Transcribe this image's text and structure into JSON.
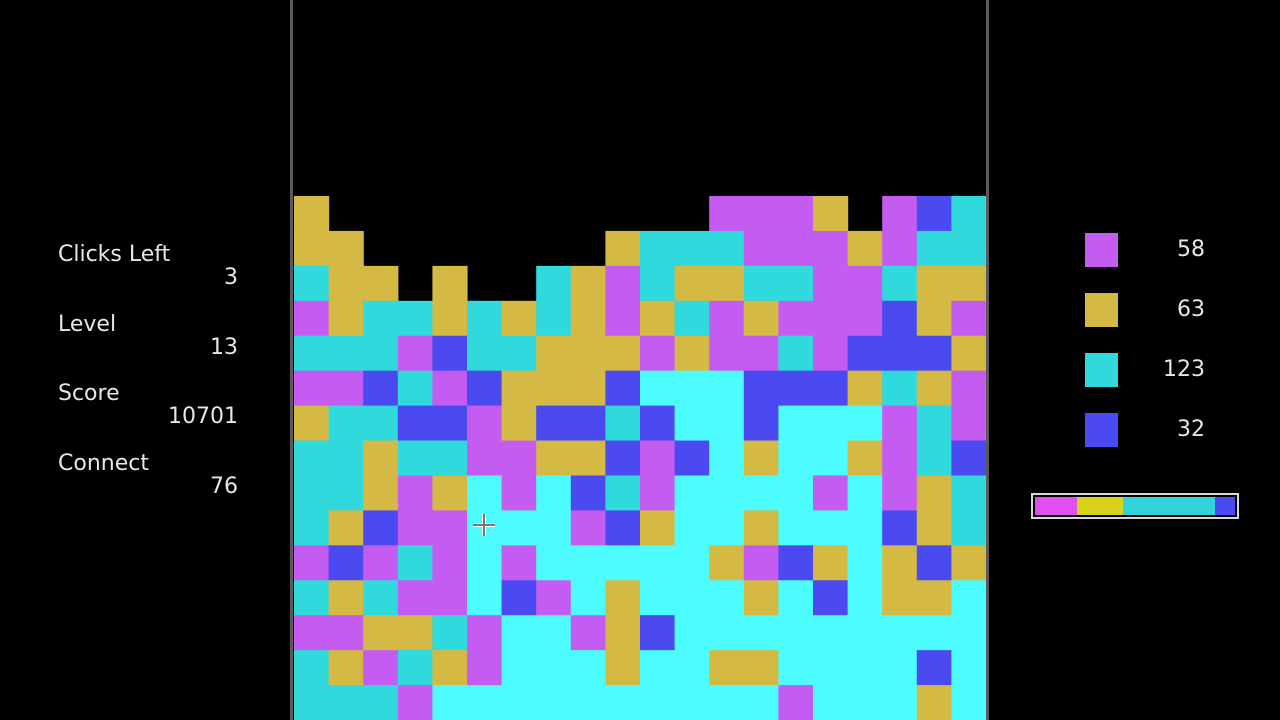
{
  "stats": {
    "clicks_left": {
      "label": "Clicks Left",
      "value": "3"
    },
    "level": {
      "label": "Level",
      "value": "13"
    },
    "score": {
      "label": "Score",
      "value": "10701"
    },
    "connect": {
      "label": "Connect",
      "value": "76"
    }
  },
  "colors": {
    "P": "#c55cf2",
    "Y": "#d4b944",
    "T": "#2fd9dc",
    "B": "#4a4af0",
    "C": "#4dfcff",
    "highlight_background": "#000000"
  },
  "legend": [
    {
      "color": "#c55cf2",
      "name": "purple",
      "count": "58"
    },
    {
      "color": "#d4b944",
      "name": "gold",
      "count": "63"
    },
    {
      "color": "#2fd9dc",
      "name": "teal",
      "count": "123"
    },
    {
      "color": "#4a4af0",
      "name": "blue",
      "count": "32"
    }
  ],
  "progress_bar": [
    {
      "color": "#e04ff0",
      "fraction": 0.21
    },
    {
      "color": "#d9d21a",
      "fraction": 0.23
    },
    {
      "color": "#33d3dc",
      "fraction": 0.46
    },
    {
      "color": "#4a4af0",
      "fraction": 0.1
    }
  ],
  "board": {
    "columns": 20,
    "rows": 15,
    "grid": [
      "Y...........PPPY.PBT",
      "YY.......YTTTPPPYPTT",
      "TYY.Y..TYPTYYTTPPTYY",
      "PYTTYTYTYPYTPYPPPBYP",
      "TTTPBTTYYYPYPPTPBBBY",
      "PPBTPBYYYBCCCBBBYTYP",
      "YTTBBPYBBTBCCBCCCPTP",
      "TTYTTPPYYBPBCYCCYPTB",
      "TTYPYCPCBTPCCCCPCPYT",
      "TYBPPCCCPBYCCYCCCBYT",
      "PBPTPCPCCCCCYPBYCYBY",
      "TYTPPCBPCYCCCYCBCYYC",
      "PPYYTPCCPYBCCCCCCCCC",
      "TYPTYPCCCYCCYYCCCCBC",
      "TTTPCCCCCCCCCCPCCCYC"
    ]
  }
}
